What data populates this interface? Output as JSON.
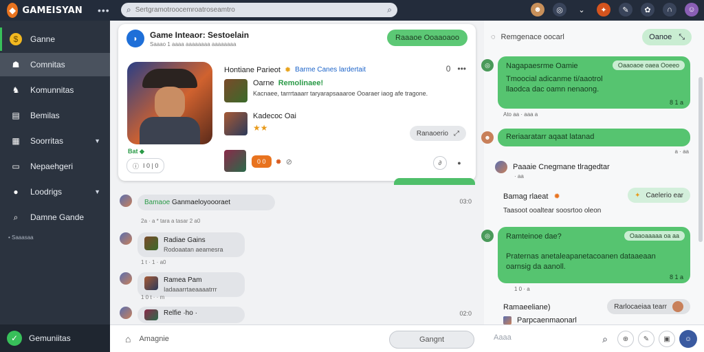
{
  "app": {
    "name": "GAMEISYAN"
  },
  "header": {
    "menu_dots": "•••",
    "search_placeholder": "Sertgramotroocemroatroseamtro"
  },
  "sidebar": {
    "items": [
      {
        "label": "Ganne",
        "icon": "coin-icon"
      },
      {
        "label": "Comnitas",
        "icon": "gamepad-icon"
      },
      {
        "label": "Komunnitas",
        "icon": "people-icon"
      },
      {
        "label": "Bemilas",
        "icon": "building-icon"
      },
      {
        "label": "Soorritas",
        "icon": "calendar-icon"
      },
      {
        "label": "Nepaehgeri",
        "icon": "chat-icon"
      },
      {
        "label": "Loodrigs",
        "icon": "record-icon"
      },
      {
        "label": "Damne Gande",
        "icon": "search-icon"
      }
    ],
    "small_label": "• Saaasaa",
    "bottom_label": "Gemuniitas"
  },
  "card": {
    "title": "Game Inteaor: Sestoelain",
    "subtitle": "Saaao 1 aaaa aaaaaaaa aaaaaaaa",
    "button": "Raaaoe Ooaaoaoo",
    "row_title": "Hontiane Parieot",
    "row_title_blue": "Barme Canes lardertait",
    "row_more": "0",
    "item1_label": "Oarne",
    "item1_green": "Remolinaee!",
    "item1_desc": "Kacnaee, tarrrtaaarr taryarapsaaaroe Ooaraer iaog afe tragone.",
    "item2_title": "Kadecoc Oai",
    "item2_stars": "★★",
    "pill": "Ranaoerio",
    "green_tag": "Bat",
    "mini_row": "I 0 |  0",
    "orange_pill": "0 0"
  },
  "chat": [
    {
      "green": "Bamaoe",
      "title": "Ganmaeloyoooraet",
      "meta": "2a · a   * tara a tasar  2  a0",
      "time": "03:0"
    },
    {
      "title": "Radiae Gains",
      "sub": "Rodoaatan aeamesra",
      "meta": "1 t ·  1 ·  a0",
      "time": ""
    },
    {
      "title": "Ramea Pam",
      "sub": "Iadaaarrtaeaaaatrrr",
      "meta": "1 0   t ·  · m",
      "time": ""
    },
    {
      "title": "Relfie ·ho ·",
      "sub": "",
      "meta": "",
      "time": "02:0"
    }
  ],
  "right_panel": {
    "head_label": "Remgenace oocarl",
    "head_button": "Oanoe",
    "bubble1": {
      "title": "Nagapaesrme Oamie",
      "tag": "Oaaoaoe oaea Ooeeo",
      "text": "Tmoocial adicanme ti/aaotrol\nllaodca dac oamn nenaong.",
      "foot": "8 1 a"
    },
    "meta1": "Ato aa ·  aaa a",
    "bubble2": {
      "title": "Reriaaratarr aqaat latanad"
    },
    "meta2": "a ·  aa",
    "user1": "Paaaie Cnegmane tlragedtar",
    "user1_sub": "·  aa",
    "user2": "Bamag rlaeat",
    "pill2": "Caelerio ear",
    "text2": "Taasoot ooaltear soosrtoo oleon",
    "bubble3": {
      "title": "Ramteinoe dae?",
      "tag": "Oaaoaaaaa oa aa",
      "text": "Praternas anetaleapanetacoanen dataaeaan\noarnsig da aanoll.",
      "foot": "8 1 a"
    },
    "meta3": "1 0 ·  a",
    "user3": "Ramaeeliane)",
    "pill3": "Rarlocaeiaa tearr",
    "user4": "Parpcaenmaonarl"
  },
  "bottom": {
    "left_label": "Amagnie",
    "pill": "Gangnt",
    "input_placeholder": "Aaaa"
  }
}
